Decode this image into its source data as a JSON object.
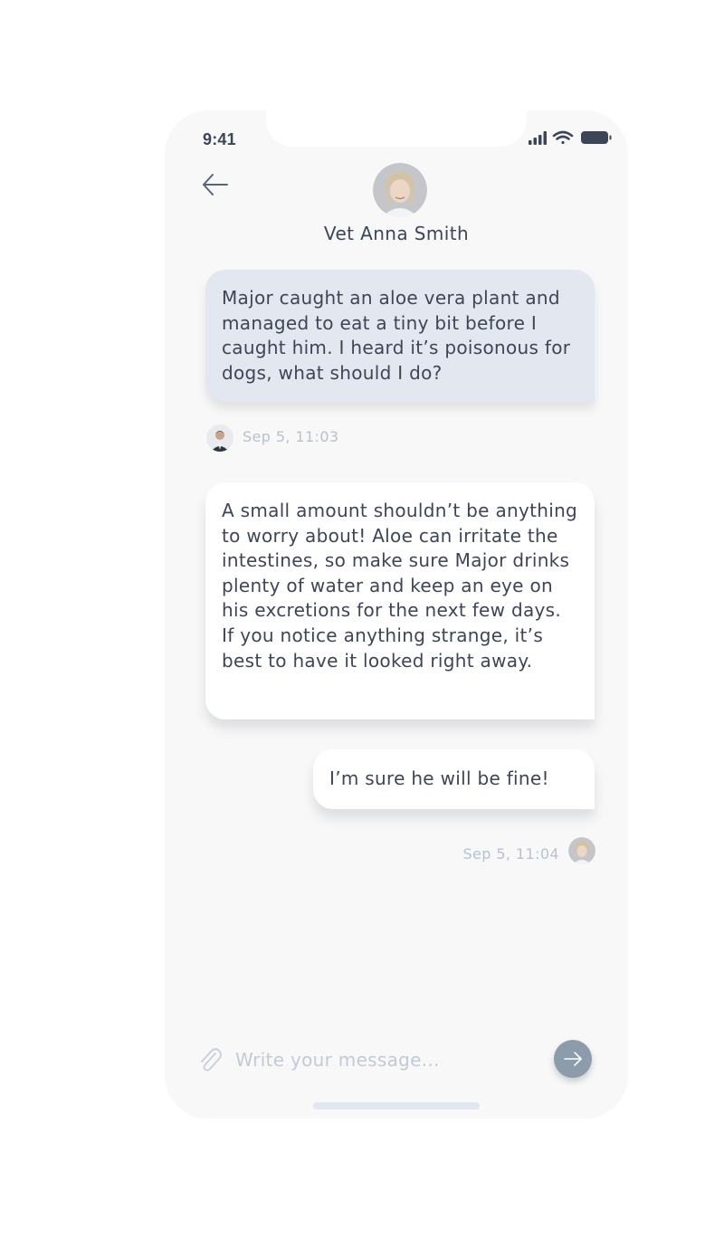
{
  "status_bar": {
    "time": "9:41",
    "icons": [
      "signal-icon",
      "wifi-icon",
      "battery-icon"
    ]
  },
  "header": {
    "back_icon": "arrow-left-icon",
    "contact_name": "Vet Anna Smith",
    "avatar": "vet-avatar"
  },
  "messages": [
    {
      "sender": "user",
      "text": "Major caught an aloe vera plant and managed to eat a tiny bit before I caught him. I heard it’s poisonous for dogs, what should I do?",
      "timestamp": "Sep 5, 11:03"
    },
    {
      "sender": "vet",
      "text": "A small amount shouldn’t be anything to worry about! Aloe can irritate the intestines, so make sure Major drinks plenty of water and keep an eye on his excretions for the next few days.\nIf you notice anything strange, it’s best to have it looked right away."
    },
    {
      "sender": "user",
      "text": "I’m sure he will be fine!",
      "timestamp": "Sep 5, 11:04"
    }
  ],
  "composer": {
    "placeholder": "Write your message...",
    "value": "",
    "attach_icon": "paperclip-icon",
    "send_icon": "arrow-right-icon"
  },
  "colors": {
    "screen_bg": "#f8f8f8",
    "user_bubble": "#e3e7ef",
    "vet_bubble": "#ffffff",
    "text": "#3e4556",
    "muted": "#b8c1cf",
    "send_button": "#8c9cab"
  }
}
